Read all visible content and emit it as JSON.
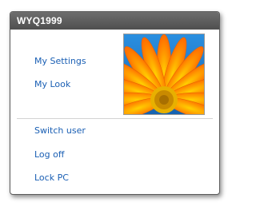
{
  "panel": {
    "username": "WYQ1999",
    "top_items": [
      {
        "label": "My Settings"
      },
      {
        "label": "My Look"
      }
    ],
    "bottom_items": [
      {
        "label": "Switch user"
      },
      {
        "label": "Log off"
      },
      {
        "label": "Lock PC"
      }
    ],
    "avatar": {
      "icon": "gerbera-flower-photo"
    }
  },
  "colors": {
    "header": "#5a5a5a",
    "link": "#1a5fb4",
    "divider": "#d3d3d3",
    "petal": "#ff8c00",
    "sky": "#1b7fcf"
  }
}
